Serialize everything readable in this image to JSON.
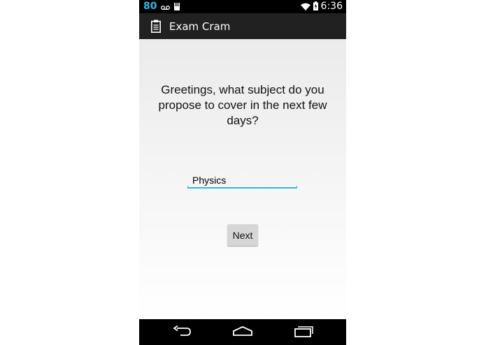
{
  "status_bar": {
    "battery_percent": "80",
    "time": "6:36",
    "icons": [
      "voicemail-icon",
      "sd-card-icon",
      "wifi-icon",
      "battery-charging-icon"
    ],
    "accent_color": "#33b5e5"
  },
  "action_bar": {
    "app_icon": "clipboard-icon",
    "title": "Exam Cram"
  },
  "main": {
    "prompt": "Greetings, what subject do you propose to cover in the next few days?",
    "subject_input": {
      "value": "Physics",
      "placeholder": ""
    },
    "next_label": "Next"
  },
  "nav_bar": {
    "buttons": [
      "back-icon",
      "home-icon",
      "recent-apps-icon"
    ]
  }
}
